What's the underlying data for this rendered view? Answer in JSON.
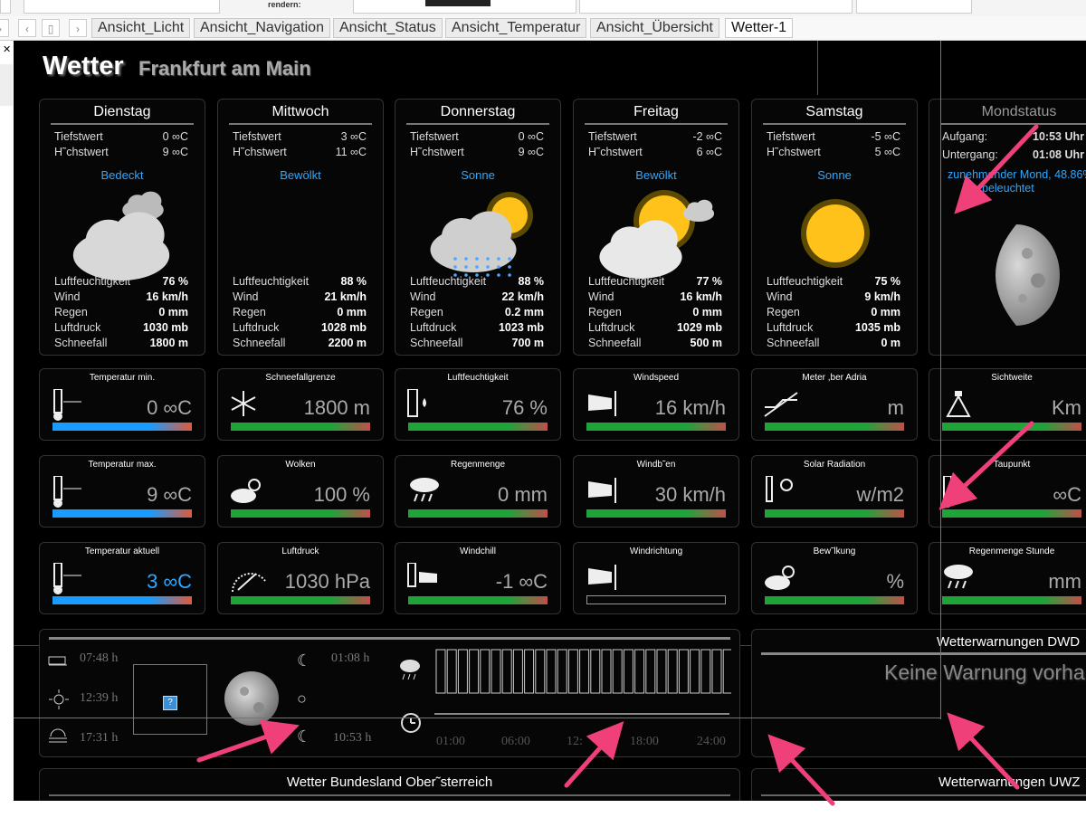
{
  "browser": {
    "top_text": "rendern:",
    "tabs": [
      "Ansicht_Licht",
      "Ansicht_Navigation",
      "Ansicht_Status",
      "Ansicht_Temperatur",
      "Ansicht_Übersicht",
      "Wetter-1"
    ],
    "active_tab": "Wetter-1"
  },
  "header": {
    "title": "Wetter",
    "city": "Frankfurt am Main"
  },
  "days": [
    {
      "name": "Dienstag",
      "min": "0 ∞C",
      "max": "9 ∞C",
      "cond": "Bedeckt",
      "icon": "overcast-cloud-icon",
      "humidity": "76 %",
      "wind": "16 km/h",
      "rain": "0 mm",
      "pressure": "1030 mb",
      "snow": "1800 m"
    },
    {
      "name": "Mittwoch",
      "min": "3 ∞C",
      "max": "11 ∞C",
      "cond": "Bewölkt",
      "icon": "cloudy-icon",
      "humidity": "88 %",
      "wind": "21 km/h",
      "rain": "0 mm",
      "pressure": "1028 mb",
      "snow": "2200 m"
    },
    {
      "name": "Donnerstag",
      "min": "0 ∞C",
      "max": "9 ∞C",
      "cond": "Sonne",
      "icon": "rain-cloud-sun-icon",
      "humidity": "88 %",
      "wind": "22 km/h",
      "rain": "0.2 mm",
      "pressure": "1023 mb",
      "snow": "700 m"
    },
    {
      "name": "Freitag",
      "min": "-2 ∞C",
      "max": "6 ∞C",
      "cond": "Bewölkt",
      "icon": "sun-behind-cloud-icon",
      "humidity": "77 %",
      "wind": "16 km/h",
      "rain": "0 mm",
      "pressure": "1029 mb",
      "snow": "500 m"
    },
    {
      "name": "Samstag",
      "min": "-5 ∞C",
      "max": "5 ∞C",
      "cond": "Sonne",
      "icon": "sun-icon",
      "humidity": "75 %",
      "wind": "9 km/h",
      "rain": "0 mm",
      "pressure": "1035 mb",
      "snow": "0 m"
    }
  ],
  "day_labels": {
    "min": "Tiefstwert",
    "max": "H˜chstwert",
    "humidity": "Luftfeuchtigkeit",
    "wind": "Wind",
    "rain": "Regen",
    "pressure": "Luftdruck",
    "snow": "Schneefall"
  },
  "moon": {
    "title": "Mondstatus",
    "rise_label": "Aufgang:",
    "rise": "10:53 Uhr",
    "set_label": "Untergang:",
    "set": "01:08 Uhr",
    "phase": "zunehmender Mond, 48.86%",
    "lit": "beleuchtet"
  },
  "tiles": [
    [
      {
        "label": "Temperatur min.",
        "value": "0 ∞C",
        "icon": "thermometer-min-icon",
        "bar": "blue"
      },
      {
        "label": "Schneefallgrenze",
        "value": "1800 m",
        "icon": "snowflake-icon",
        "bar": "green"
      },
      {
        "label": "Luftfeuchtigkeit",
        "value": "76 %",
        "icon": "humidity-drops-icon",
        "bar": "green"
      },
      {
        "label": "Windspeed",
        "value": "16 km/h",
        "icon": "windsock-kmh-icon",
        "bar": "green"
      },
      {
        "label": "Meter ,ber Adria",
        "value": "m",
        "icon": "altitude-icon",
        "bar": "green"
      },
      {
        "label": "Sichtweite",
        "value": "Km",
        "icon": "visibility-icon",
        "bar": "green"
      }
    ],
    [
      {
        "label": "Temperatur max.",
        "value": "9 ∞C",
        "icon": "thermometer-max-icon",
        "bar": "blue"
      },
      {
        "label": "Wolken",
        "value": "100 %",
        "icon": "cloud-sun-icon",
        "bar": "green"
      },
      {
        "label": "Regenmenge",
        "value": "0 mm",
        "icon": "rain-cloud-icon",
        "bar": "green"
      },
      {
        "label": "Windb˜en",
        "value": "30 km/h",
        "icon": "windsock-bft-icon",
        "bar": "green"
      },
      {
        "label": "Solar Radiation",
        "value": "w/m2",
        "icon": "solar-lux-icon",
        "bar": "green"
      },
      {
        "label": "Taupunkt",
        "value": "∞C",
        "icon": "dewpoint-icon",
        "bar": "green"
      }
    ],
    [
      {
        "label": "Temperatur aktuell",
        "value": "3 ∞C",
        "icon": "thermometer-icon",
        "bar": "blue"
      },
      {
        "label": "Luftdruck",
        "value": "1030 hPa",
        "icon": "barometer-icon",
        "bar": "green"
      },
      {
        "label": "Windchill",
        "value": "-1 ∞C",
        "icon": "windchill-icon",
        "bar": "green"
      },
      {
        "label": "Windrichtung",
        "value": "",
        "icon": "windsock-icon",
        "bar": "empty"
      },
      {
        "label": "Bew˜lkung",
        "value": "%",
        "icon": "cloud-sun-icon",
        "bar": "green"
      },
      {
        "label": "Regenmenge Stunde",
        "value": "mm",
        "icon": "rain-cloud-icon",
        "bar": "green"
      }
    ]
  ],
  "bottom": {
    "sun_times": [
      "07:48 h",
      "12:39 h",
      "17:31 h"
    ],
    "moon_times": [
      "01:08 h",
      "10:53 h"
    ],
    "hours": [
      "01:00",
      "06:00",
      "12:",
      "18:00",
      "24:00"
    ],
    "placeholder": "?"
  },
  "warnings": {
    "dwd_title": "Wetterwarnungen DWD",
    "dwd_text": "Keine Warnung vorha",
    "uwz_title": "Wetterwarnungen UWZ",
    "state_title": "Wetter Bundesland Ober˜sterreich"
  },
  "colors": {
    "accent": "#2fa8ff",
    "arrow": "#f0407a",
    "panel_border": "#333",
    "orange_line": "#b06a1e"
  }
}
